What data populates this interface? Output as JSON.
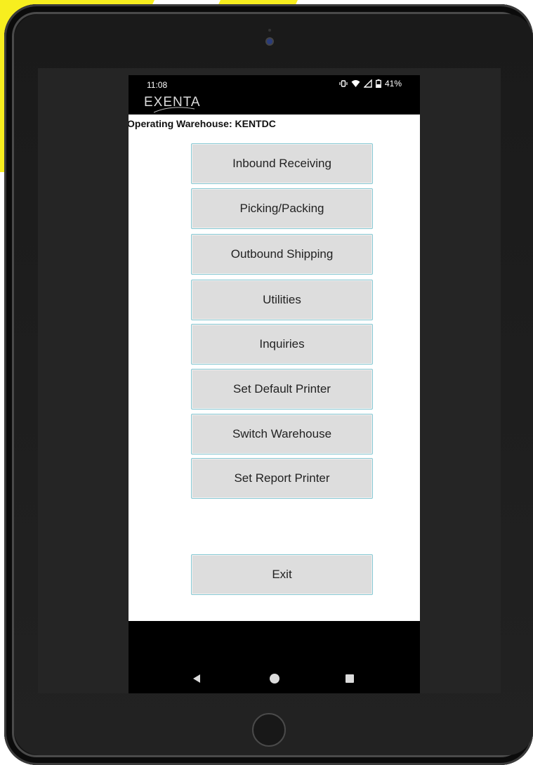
{
  "status_bar": {
    "time": "11:08",
    "battery": "41%"
  },
  "logo": "EXENTA",
  "header": {
    "operating_warehouse": "Operating Warehouse: KENTDC"
  },
  "menu": {
    "inbound_receiving": "Inbound Receiving",
    "picking_packing": "Picking/Packing",
    "outbound_shipping": "Outbound Shipping",
    "utilities": "Utilities",
    "inquiries": "Inquiries",
    "set_default_printer": "Set Default Printer",
    "switch_warehouse": "Switch Warehouse",
    "set_report_printer": "Set Report Printer",
    "exit": "Exit"
  },
  "icons": {
    "vibrate": "vibrate-icon",
    "wifi": "wifi-icon",
    "signal": "signal-icon",
    "battery": "battery-icon",
    "back": "back-icon",
    "home": "home-icon",
    "recent": "recent-apps-icon"
  },
  "colors": {
    "accent": "#f7ee1f",
    "button_bg": "#dddddd",
    "button_border": "#86c8d3",
    "device": "#121212"
  }
}
